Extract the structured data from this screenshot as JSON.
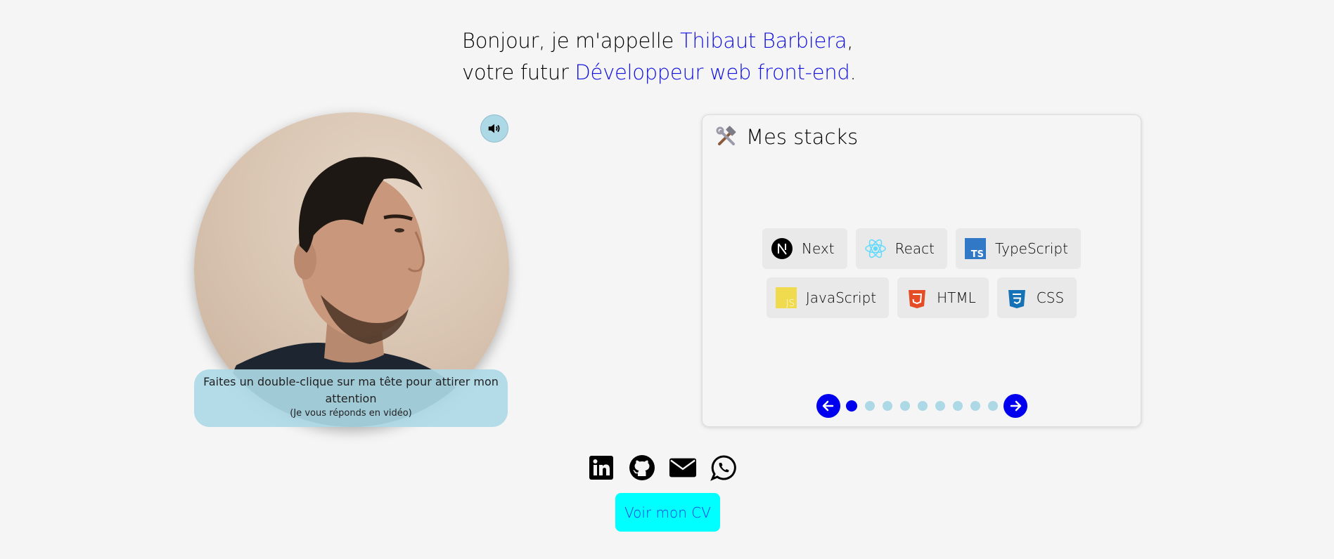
{
  "intro": {
    "line1_prefix": "Bonjour, je m'appelle ",
    "name": "Thibaut Barbiera",
    "line1_suffix": ",",
    "line2_prefix": "votre futur ",
    "role": "Développeur web front-end",
    "line2_suffix": ".",
    "highlight_color": "#1010e0"
  },
  "portrait": {
    "sound_icon": "speaker-icon",
    "hint_main": "Faites un double-clique sur ma tête pour attirer mon attention",
    "hint_small": "(Je vous réponds en vidéo)"
  },
  "stacks": {
    "title_icon": "hammer-wrench-icon",
    "title": "Mes stacks",
    "rows": [
      [
        {
          "label": "Next",
          "icon": "nextjs-icon"
        },
        {
          "label": "React",
          "icon": "react-icon"
        },
        {
          "label": "TypeScript",
          "icon": "typescript-icon"
        }
      ],
      [
        {
          "label": "JavaScript",
          "icon": "javascript-icon"
        },
        {
          "label": "HTML",
          "icon": "html5-icon"
        },
        {
          "label": "CSS",
          "icon": "css3-icon"
        }
      ]
    ],
    "pagination": {
      "total": 9,
      "active": 1
    }
  },
  "socials": [
    "linkedin-icon",
    "github-icon",
    "email-icon",
    "whatsapp-icon"
  ],
  "cv_button": "Voir mon CV",
  "colors": {
    "accent": "#0000ee",
    "light_blue": "#add8e6",
    "cyan": "#00ffff"
  }
}
